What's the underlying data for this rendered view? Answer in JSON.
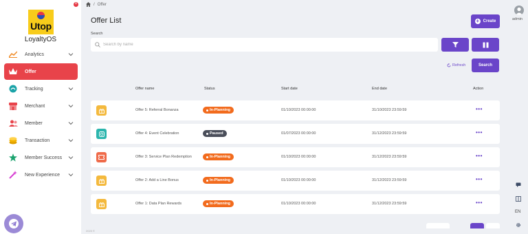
{
  "app": {
    "logo_text": "Utop",
    "brand_name": "LoyaltyOS"
  },
  "sidebar": {
    "items": [
      {
        "label": "Analytics",
        "icon": "chart-line-icon",
        "color": "#f08a24"
      },
      {
        "label": "Offer",
        "icon": "crown-icon",
        "color": "#ffffff"
      },
      {
        "label": "Tracking",
        "icon": "tracking-icon",
        "color": "#1ba3a8"
      },
      {
        "label": "Merchant",
        "icon": "store-icon",
        "color": "#e8434a"
      },
      {
        "label": "Member",
        "icon": "users-icon",
        "color": "#e8434a"
      },
      {
        "label": "Transaction",
        "icon": "coins-icon",
        "color": "#f4b400"
      },
      {
        "label": "Member Success",
        "icon": "star-icon",
        "color": "#1ba36e"
      },
      {
        "label": "New Experience",
        "icon": "magic-wand-icon",
        "color": "#d63bd1"
      }
    ]
  },
  "breadcrumb": {
    "current": "Offer"
  },
  "page": {
    "title": "Offer List",
    "create_label": "Create"
  },
  "search": {
    "label": "Search",
    "placeholder": "Search by name",
    "refresh_label": "Refresh",
    "button_label": "Search"
  },
  "table": {
    "columns": [
      "Offer name",
      "Status",
      "Start date",
      "End date",
      "Action"
    ],
    "rows": [
      {
        "name": "Offer 5: Referral Bonanza",
        "status": "In-Planning",
        "status_color": "#f26b1d",
        "start": "01/10/2023 00:00:00",
        "end": "31/10/2023 23:59:59",
        "icon_color": "#f4b93d",
        "icon": "gift-icon"
      },
      {
        "name": "Offer 4: Event Celebration",
        "status": "Paused",
        "status_color": "#4a4e5a",
        "start": "01/07/2023 00:00:00",
        "end": "31/12/2023 23:59:59",
        "icon_color": "#2bb5ad",
        "icon": "clock-icon"
      },
      {
        "name": "Offer 3: Service Plan Redemption",
        "status": "In-Planning",
        "status_color": "#f26b1d",
        "start": "01/10/2023 00:00:00",
        "end": "31/12/2023 23:59:59",
        "icon_color": "#ef6b4a",
        "icon": "ticket-icon"
      },
      {
        "name": "Offer 2: Add a Line Bonus",
        "status": "In-Planning",
        "status_color": "#f26b1d",
        "start": "01/10/2023 00:00:00",
        "end": "31/12/2023 23:59:59",
        "icon_color": "#f4b93d",
        "icon": "gift-icon"
      },
      {
        "name": "Offer 1: Data Plan Rewards",
        "status": "In-Planning",
        "status_color": "#f26b1d",
        "start": "01/10/2023 00:00:00",
        "end": "31/12/2023 23:59:59",
        "icon_color": "#f4b93d",
        "icon": "gift-icon"
      }
    ],
    "action_glyph": "•••"
  },
  "footer": {
    "copyright": "2023 ©"
  },
  "user": {
    "name": "admin"
  },
  "rail": {
    "language": "EN"
  },
  "colors": {
    "primary": "#6a45c9",
    "active_nav": "#e8434a",
    "background": "#eef0f4"
  }
}
